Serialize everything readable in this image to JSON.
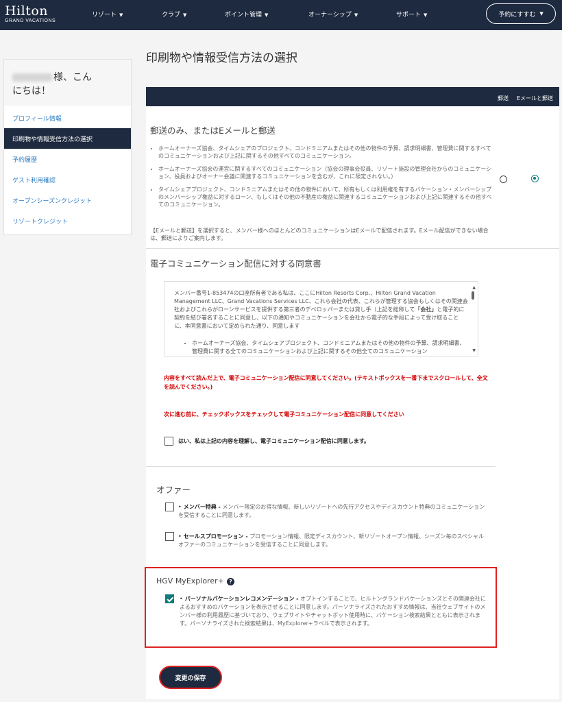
{
  "brand": {
    "name": "Hilton",
    "sub": "GRAND VACATIONS"
  },
  "nav": {
    "items": [
      "リゾート",
      "クラブ",
      "ポイント管理",
      "オーナーシップ",
      "サポート"
    ],
    "reserve": "予約にすすむ"
  },
  "sidebar": {
    "greeting_suffix": "様、こん",
    "greeting_line2": "にちは！",
    "items": [
      "プロフィール情報",
      "印刷物や情報受信方法の選択",
      "予約履歴",
      "ゲスト利用確認",
      "オープンシーズンクレジット",
      "リゾートクレジット"
    ]
  },
  "page": {
    "title": "印刷物や情報受信方法の選択"
  },
  "columns": {
    "mail": "郵送",
    "email_mail": "Eメールと郵送"
  },
  "delivery": {
    "title": "郵送のみ、またはEメールと郵送",
    "bullets": [
      "ホームオーナーズ協会、タイムシェアのプロジェクト、コンドミニアムまたはその他の物件の予算、請求明細書、管理費に関するすべてのコミュニケーションおよび上記に関するその他すべてのコミュニケーション。",
      "ホームオーナーズ協会の運営に関するすべてのコミュニケーション（協会の理事会役員、リゾート施設の管理会社からのコミュニケーション、役員およびオーナー会議に関連するコミュニケーションを含むが、これに限定されない。）",
      "タイムシェアプロジェクト、コンドミニアムまたはその他の物件において、所有もしくは利用権を有するバケーション・メンバーシップのメンバーシップ権益に対するローン、もしくはその他の不動産の権益に関連するコミュニケーションおよび上記に関連するその他すべてのコミュニケーション。"
    ],
    "note": "【Eメールと郵送】を選択すると、メンバー様へのほとんどのコミュニケーションはEメールで配信されます。Eメール配信ができない場合は、郵送によりご案内します。"
  },
  "consent": {
    "title": "電子コミュニケーション配信に対する同意書",
    "text_a": "メンバー番号1-853474の口座所有者である私は、ここにHilton Resorts Corp.、Hilton Grand Vacation Management LLC、Grand Vacations Services LLC、これら会社の代表、これらが管理する協会もしくはその関連会社およびこれらがローンサービスを提供する第三者のデベロッパーまたは貸し手（上記を総称して",
    "text_bold": "「会社」",
    "text_b": "と電子的に契約を結び署名することに同意し、以下の通知やコミュニケーションを会社から電子的な手段によって受け取ることに、本同意書において定められた通り、同意します",
    "list_item": "ホームオーナーズ協会、タイムシェアプロジェクト、コンドミニアムまたはその他の物件の予算、請求明細書、管理費に関する全てのコミュニケーションおよび上記に関するその他全てのコミュニケーション",
    "warn1": "内容をすべて読んだ上で、電子コミュニケーション配信に同意してください。(テキストボックスを一番下までスクロールして、全文を読んでください。)",
    "warn2": "次に進む前に、チェックボックスをチェックして電子コミュニケーション配信に同意してください",
    "agree_label": "はい、私は上記の内容を理解し、電子コミュニケーション配信に同意します。"
  },
  "offers": {
    "title": "オファー",
    "items": [
      {
        "bold": "メンバー特典 -",
        "text": " メンバー限定のお得な情報、新しいリゾートへの先行アクセスやディスカウント特典のコミュニケーションを受信することに同意します。"
      },
      {
        "bold": "セールスプロモーション -",
        "text": " プロモーション情報、限定ディスカウント、新リゾートオープン情報、シーズン毎のスペシャルオファーのコミュニケーションを受信することに同意します。"
      }
    ]
  },
  "hgv": {
    "title": "HGV MyExplorer+",
    "help": "?",
    "bold": "パーソナルバケーションレコメンデーション -",
    "text": " オプトインすることで、ヒルトングランドバケーションズとその関連会社によるおすすめのバケーションを表示させることに同意します。パーソナライズされたおすすめ情報は、当社ウェブサイトのメンバー様の利用履歴に基づいており、ウェブサイトやチャットボット使用時に、バケーション検索結果とともに表示されます。パーソナライズされた検索結果は、MyExplorer+ラベルで表示されます。"
  },
  "save": "変更の保存",
  "icons": {
    "caret": "caret-down-icon",
    "help": "question-circle-icon",
    "check": "checkmark-icon"
  },
  "colors": {
    "navy": "#1e2a3f",
    "link": "#2a7bc1",
    "warn": "#d40000",
    "teal": "#117a7a",
    "highlight": "#e02020"
  }
}
